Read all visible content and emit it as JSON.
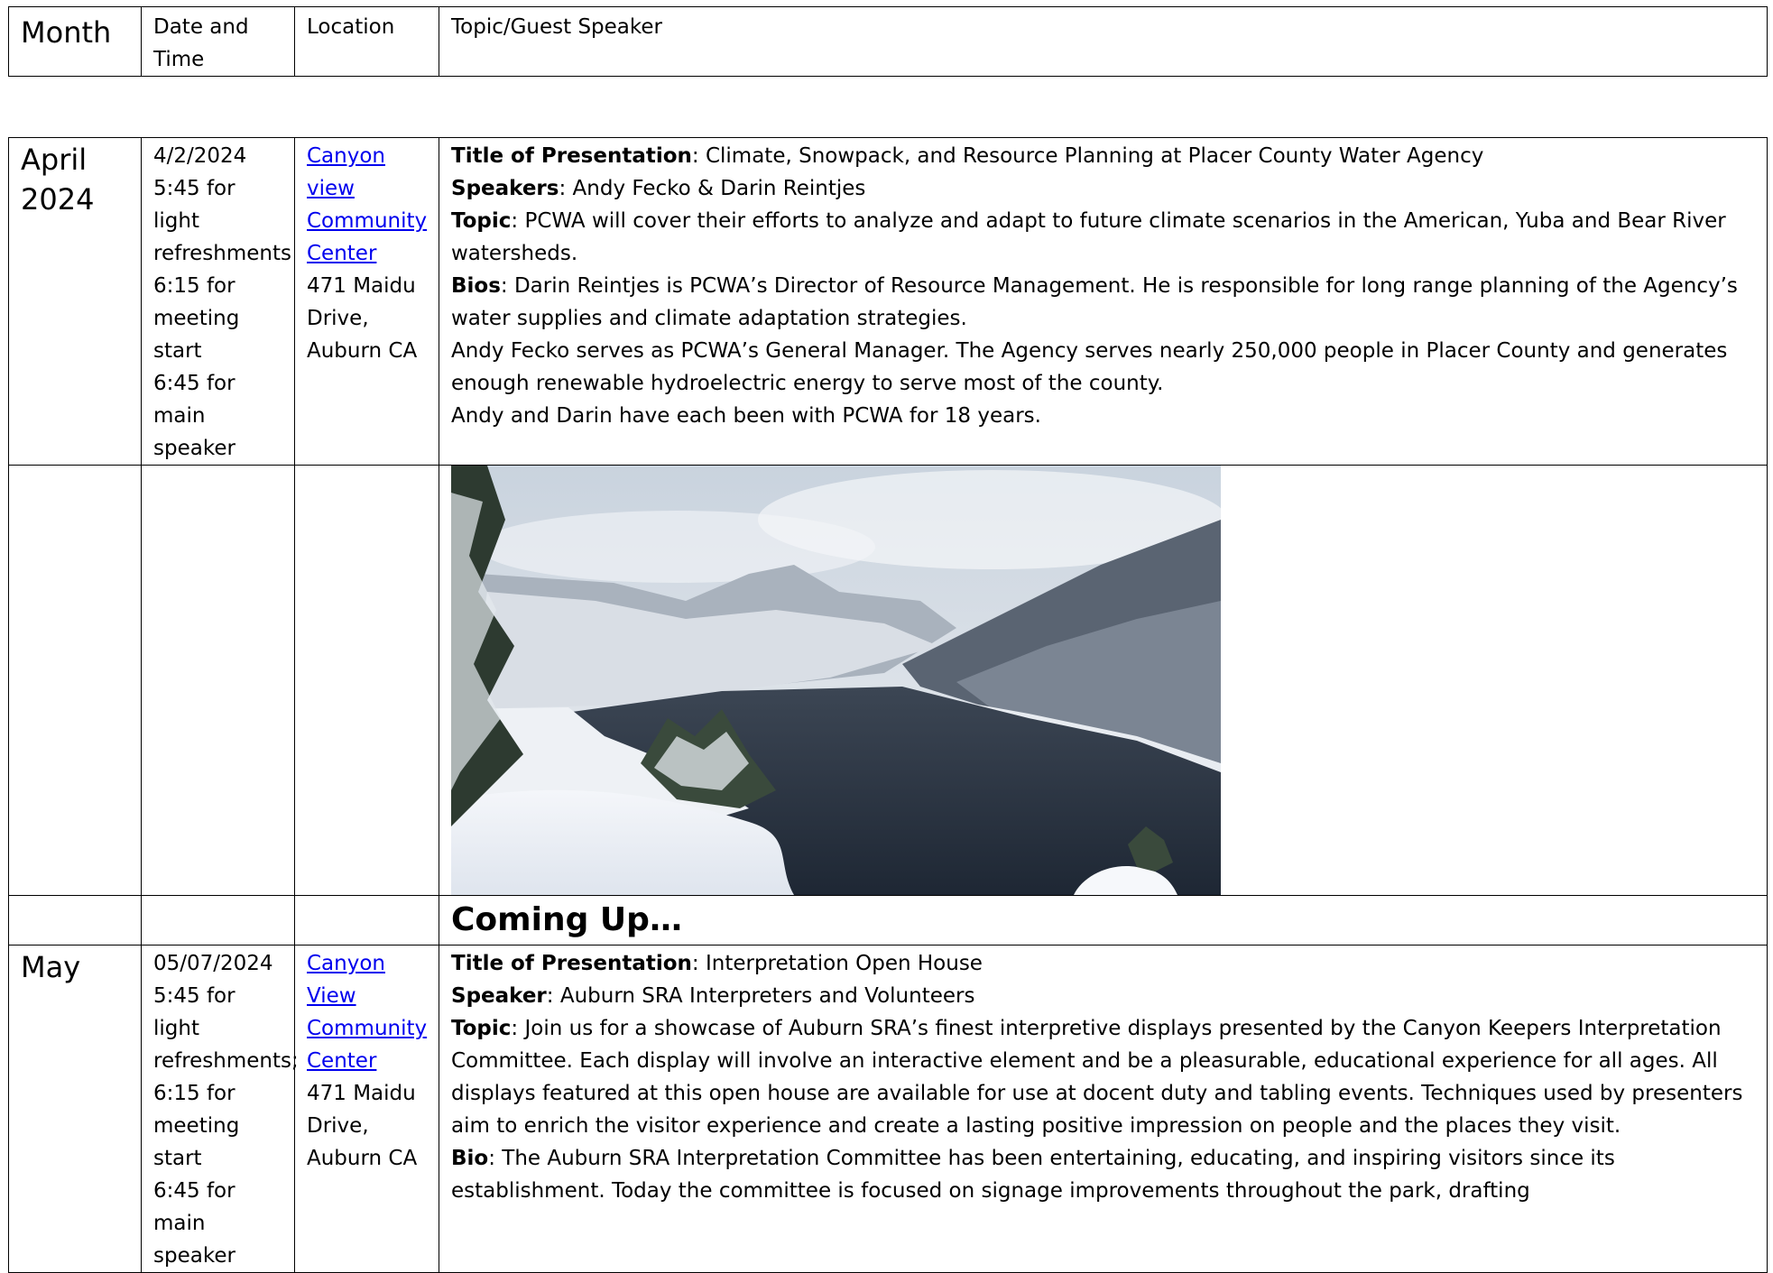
{
  "header": {
    "month": "Month",
    "date_time": "Date and Time",
    "location": "Location",
    "topic": "Topic/Guest Speaker"
  },
  "april": {
    "month": "April 2024",
    "date": "4/2/2024",
    "time_lines": [
      "5:45 for light refreshments",
      "6:15 for meeting start",
      "6:45 for main speaker"
    ],
    "location_link": "Canyon view Community Center",
    "address": "471 Maidu Drive, Auburn  CA",
    "title_label": "Title of Presentation",
    "title_text": ":  Climate, Snowpack, and Resource Planning at Placer County Water Agency",
    "speakers_label": "Speakers",
    "speakers_text": ": Andy Fecko & Darin Reintjes",
    "topic_label": "Topic",
    "topic_text": ":  PCWA will cover their efforts to analyze and adapt to future climate scenarios in the American, Yuba and Bear River watersheds.",
    "bios_label": "Bios",
    "bios_text": ": Darin Reintjes is PCWA’s Director of Resource Management.  He is responsible for long range planning of the Agency’s water supplies and climate adaptation strategies.",
    "bio2": "Andy Fecko serves as PCWA’s General Manager.  The Agency serves nearly 250,000 people in Placer County and generates enough renewable hydroelectric energy to serve most of the county.",
    "bio3": "Andy and Darin have each been with PCWA for 18 years."
  },
  "coming_up": "Coming Up…",
  "may": {
    "month": "May",
    "date": "05/07/2024",
    "time_lines": [
      "5:45 for light refreshments;",
      "6:15 for meeting start",
      "6:45 for main speaker"
    ],
    "location_link": "Canyon View Community Center",
    "address": "471 Maidu Drive, Auburn  CA",
    "title_label": "Title of Presentation",
    "title_text": ":  Interpretation Open House",
    "speaker_label": "Speaker",
    "speaker_text": ": Auburn SRA Interpreters and Volunteers",
    "topic_label": "Topic",
    "topic_text": ": Join us for a showcase of Auburn SRA’s finest interpretive displays presented by the Canyon Keepers Interpretation Committee. Each display will involve an interactive element and be a pleasurable, educational experience for all ages. All displays featured at this open house are available for use at docent duty and tabling events. Techniques used by presenters aim to enrich the visitor experience and create a lasting positive impression on people and the places they visit.",
    "bio_label": "Bio",
    "bio_text": ": The Auburn SRA Interpretation Committee has been entertaining, educating, and inspiring visitors since its establishment. Today the committee is focused on signage improvements throughout the park, drafting"
  },
  "colors": {
    "link": "#0000ee",
    "border": "#000000"
  }
}
